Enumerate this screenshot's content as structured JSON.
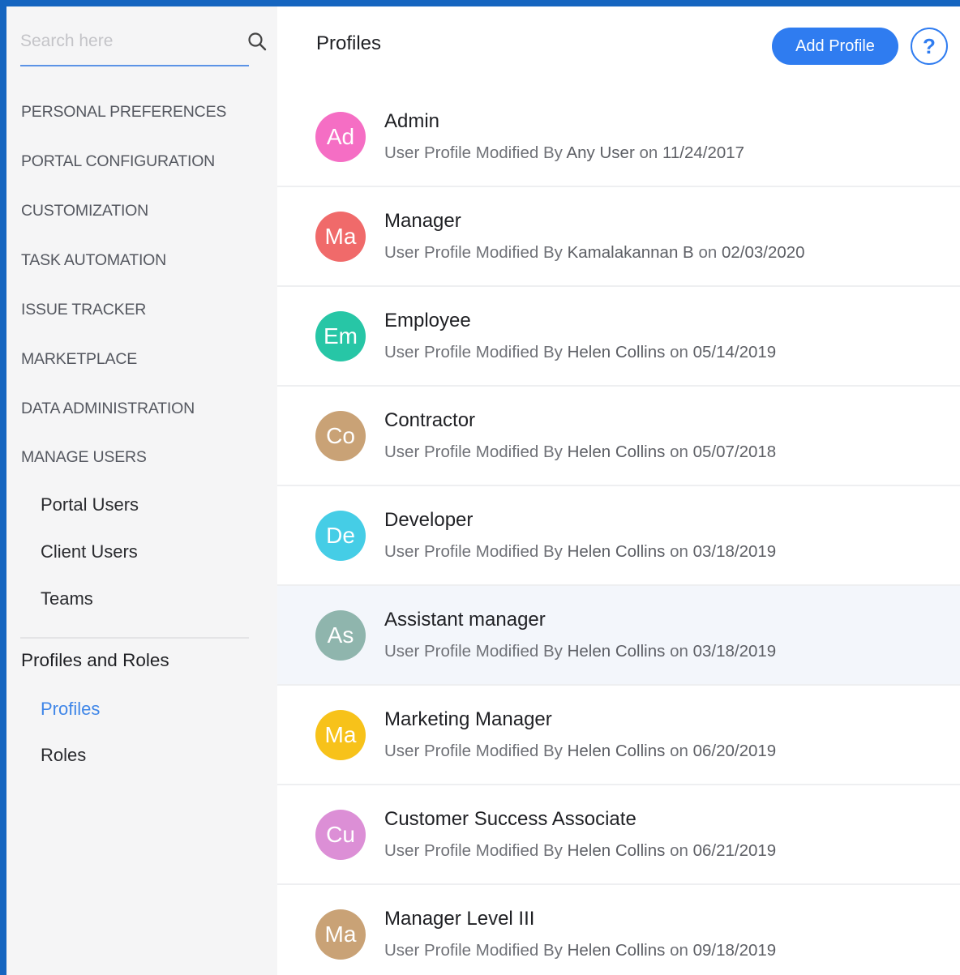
{
  "search": {
    "placeholder": "Search here",
    "icon": "search-icon"
  },
  "sidebar": {
    "sections": [
      "PERSONAL PREFERENCES",
      "PORTAL CONFIGURATION",
      "CUSTOMIZATION",
      "TASK AUTOMATION",
      "ISSUE TRACKER",
      "MARKETPLACE",
      "DATA ADMINISTRATION",
      "MANAGE USERS"
    ],
    "manage_users_items": [
      "Portal Users",
      "Client Users",
      "Teams"
    ],
    "group_title": "Profiles and Roles",
    "group_items": [
      "Profiles",
      "Roles"
    ],
    "active_item": "Profiles"
  },
  "header": {
    "title": "Profiles",
    "add_button": "Add Profile",
    "help_label": "?"
  },
  "colors": {
    "accent": "#2f7cf0",
    "frame": "#1565c0",
    "active_link": "#3f86e8"
  },
  "profiles": [
    {
      "initials": "Ad",
      "name": "Admin",
      "prefix": "User Profile Modified By",
      "user": "Any User",
      "on": "on",
      "date": "11/24/2017",
      "color": "#f56ec4"
    },
    {
      "initials": "Ma",
      "name": "Manager",
      "prefix": "User Profile Modified By",
      "user": "Kamalakannan B",
      "on": "on",
      "date": "02/03/2020",
      "color": "#f06a6a"
    },
    {
      "initials": "Em",
      "name": "Employee",
      "prefix": "User Profile Modified By",
      "user": "Helen Collins",
      "on": "on",
      "date": "05/14/2019",
      "color": "#27c6a6"
    },
    {
      "initials": "Co",
      "name": "Contractor",
      "prefix": "User Profile Modified By",
      "user": "Helen Collins",
      "on": "on",
      "date": "05/07/2018",
      "color": "#c9a276"
    },
    {
      "initials": "De",
      "name": "Developer",
      "prefix": "User Profile Modified By",
      "user": "Helen Collins",
      "on": "on",
      "date": "03/18/2019",
      "color": "#45cde6"
    },
    {
      "initials": "As",
      "name": "Assistant manager",
      "prefix": "User Profile Modified By",
      "user": "Helen Collins",
      "on": "on",
      "date": "03/18/2019",
      "color": "#8fb5ad"
    },
    {
      "initials": "Ma",
      "name": "Marketing Manager",
      "prefix": "User Profile Modified By",
      "user": "Helen Collins",
      "on": "on",
      "date": "06/20/2019",
      "color": "#f7c21a"
    },
    {
      "initials": "Cu",
      "name": "Customer Success Associate",
      "prefix": "User Profile Modified By",
      "user": "Helen Collins",
      "on": "on",
      "date": "06/21/2019",
      "color": "#dc8fd6"
    },
    {
      "initials": "Ma",
      "name": "Manager Level III",
      "prefix": "User Profile Modified By",
      "user": "Helen Collins",
      "on": "on",
      "date": "09/18/2019",
      "color": "#c9a276"
    }
  ],
  "hovered_row": 5
}
